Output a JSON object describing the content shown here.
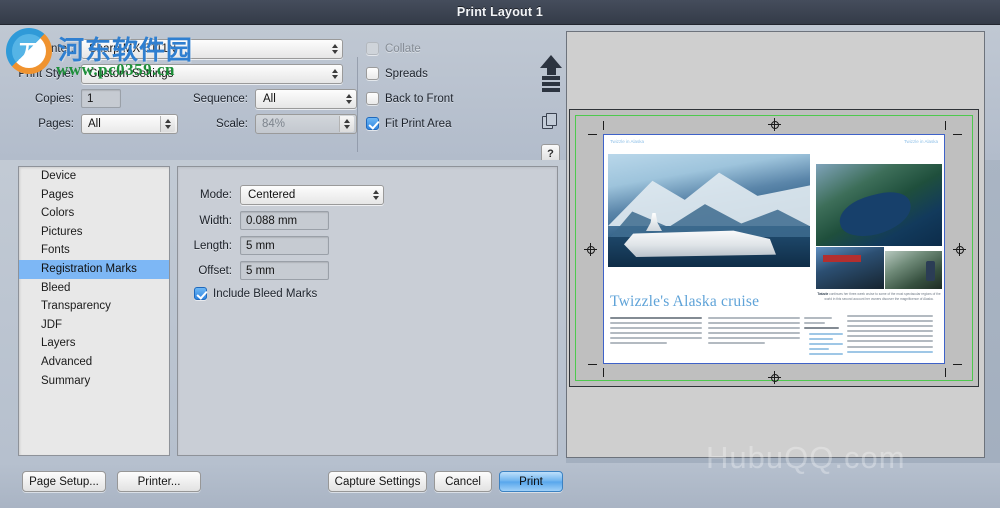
{
  "window": {
    "title": "Print Layout 1"
  },
  "top_settings": {
    "printer_label": "Printer:",
    "printer_value": "Sharp MX-5111N",
    "print_style_label": "Print Style:",
    "print_style_value": "Custom Settings",
    "copies_label": "Copies:",
    "copies_value": "1",
    "pages_label": "Pages:",
    "pages_value": "All",
    "sequence_label": "Sequence:",
    "sequence_value": "All",
    "scale_label": "Scale:",
    "scale_value": "84%",
    "checkboxes": [
      {
        "label": "Collate",
        "checked": false,
        "disabled": true
      },
      {
        "label": "Spreads",
        "checked": false,
        "disabled": false
      },
      {
        "label": "Back to Front",
        "checked": false,
        "disabled": false
      },
      {
        "label": "Fit Print Area",
        "checked": true,
        "disabled": false
      }
    ],
    "help_label": "?"
  },
  "sidebar": {
    "items": [
      {
        "label": "Device",
        "selected": false
      },
      {
        "label": "Pages",
        "selected": false
      },
      {
        "label": "Colors",
        "selected": false
      },
      {
        "label": "Pictures",
        "selected": false
      },
      {
        "label": "Fonts",
        "selected": false
      },
      {
        "label": "Registration Marks",
        "selected": true
      },
      {
        "label": "Bleed",
        "selected": false
      },
      {
        "label": "Transparency",
        "selected": false
      },
      {
        "label": "JDF",
        "selected": false
      },
      {
        "label": "Layers",
        "selected": false
      },
      {
        "label": "Advanced",
        "selected": false
      },
      {
        "label": "Summary",
        "selected": false
      }
    ]
  },
  "detail": {
    "mode_label": "Mode:",
    "mode_value": "Centered",
    "width_label": "Width:",
    "width_value": "0.088 mm",
    "length_label": "Length:",
    "length_value": "5 mm",
    "offset_label": "Offset:",
    "offset_value": "5 mm",
    "bleed_marks_label": "Include Bleed Marks",
    "bleed_marks_checked": true
  },
  "buttons": {
    "page_setup": "Page Setup...",
    "printer": "Printer...",
    "capture_settings": "Capture Settings",
    "cancel": "Cancel",
    "print": "Print"
  },
  "preview": {
    "page_header_left": "Twizzle in Alaska",
    "page_header_right": "Twizzle in Alaska",
    "headline": "Twizzle's  Alaska cruise",
    "lead_strong": "Twizzle",
    "lead_rest": " continues her three-week cruise to some of the most spectacular regions of the world in this second account her owners discover the magnificence of Alaska."
  },
  "watermarks": {
    "logo_mark": "刀",
    "site_name_cn": "河东软件园",
    "site_url": "www.pc0359.cn",
    "bottom_right": "HubuQQ.com"
  },
  "colors": {
    "titlebar": "#3b4352",
    "accent_selection": "#7db7f5",
    "default_button": "#6cb3ef",
    "bleed_box": "#4ec94e",
    "page_border": "#3f62c8",
    "headline": "#5fa3d8"
  }
}
